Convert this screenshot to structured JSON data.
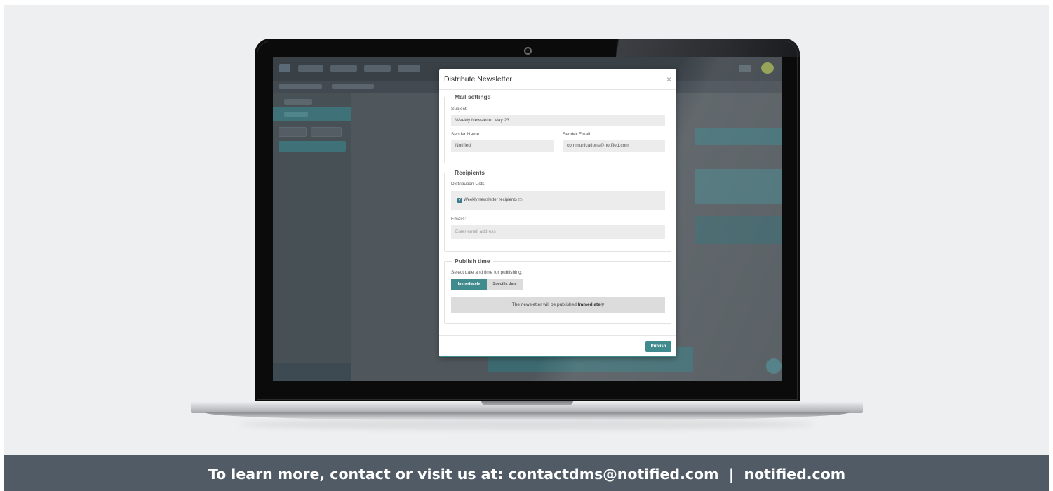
{
  "modal": {
    "title": "Distribute Newsletter",
    "close_icon": "×",
    "mail_settings": {
      "legend": "Mail settings",
      "subject_label": "Subject:",
      "subject_value": "Weekly Newsletter May 23",
      "sender_name_label": "Sender Name:",
      "sender_name_value": "Notified",
      "sender_email_label": "Sender Email:",
      "sender_email_value": "communications@notified.com"
    },
    "recipients": {
      "legend": "Recipients",
      "lists_label": "Distribution Lists:",
      "list_item": "Weekly newsletter recipients",
      "list_count": "(5)",
      "list_checked": true,
      "emails_label": "Emails:",
      "emails_placeholder": "Enter email address"
    },
    "publish_time": {
      "legend": "Publish time",
      "select_label": "Select date and time for publishing:",
      "option_immediately": "Immediately",
      "option_specific": "Specific date",
      "selected": "Immediately",
      "info_prefix": "The newsletter will be published",
      "info_bold": "Immediately"
    },
    "publish_button": "Publish"
  },
  "colors": {
    "accent": "#3f8b8d",
    "footer_band": "#505b66"
  },
  "footer": {
    "text": "To learn more, contact or visit us at: contactdms@notified.com  |  notified.com"
  }
}
